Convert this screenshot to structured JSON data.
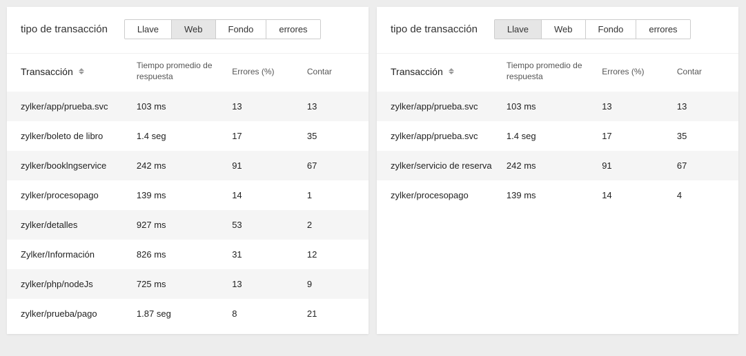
{
  "left": {
    "title": "tipo de transacción",
    "tabs": [
      {
        "label": "Llave",
        "active": false
      },
      {
        "label": "Web",
        "active": true
      },
      {
        "label": "Fondo",
        "active": false
      },
      {
        "label": "errores",
        "active": false
      }
    ],
    "headers": {
      "transaction": "Transacción",
      "avg_response": "Tiempo promedio de respuesta",
      "errors": "Errores (%)",
      "count": "Contar"
    },
    "rows": [
      {
        "tx": "zylker/app/prueba.svc",
        "rt": "103 ms",
        "err": "13",
        "cnt": "13"
      },
      {
        "tx": "zylker/boleto de libro",
        "rt": "1.4 seg",
        "err": "17",
        "cnt": "35"
      },
      {
        "tx": "zylker/booklngservice",
        "rt": "242 ms",
        "err": "91",
        "cnt": "67"
      },
      {
        "tx": "zylker/procesopago",
        "rt": "139 ms",
        "err": "14",
        "cnt": "1"
      },
      {
        "tx": "zylker/detalles",
        "rt": "927 ms",
        "err": "53",
        "cnt": "2"
      },
      {
        "tx": "Zylker/Información",
        "rt": "826 ms",
        "err": "31",
        "cnt": "12"
      },
      {
        "tx": "zylker/php/nodeJs",
        "rt": "725 ms",
        "err": "13",
        "cnt": "9"
      },
      {
        "tx": "zylker/prueba/pago",
        "rt": "1.87 seg",
        "err": "8",
        "cnt": "21"
      }
    ]
  },
  "right": {
    "title": "tipo de transacción",
    "tabs": [
      {
        "label": "Llave",
        "active": true
      },
      {
        "label": "Web",
        "active": false
      },
      {
        "label": "Fondo",
        "active": false
      },
      {
        "label": "errores",
        "active": false
      }
    ],
    "headers": {
      "transaction": "Transacción",
      "avg_response": "Tiempo promedio de respuesta",
      "errors": "Errores (%)",
      "count": "Contar"
    },
    "rows": [
      {
        "tx": "zylker/app/prueba.svc",
        "rt": "103 ms",
        "err": "13",
        "cnt": "13"
      },
      {
        "tx": "zylker/app/prueba.svc",
        "rt": "1.4 seg",
        "err": "17",
        "cnt": "35"
      },
      {
        "tx": "zylker/servicio de reserva",
        "rt": "242 ms",
        "err": "91",
        "cnt": "67"
      },
      {
        "tx": "zylker/procesopago",
        "rt": "139 ms",
        "err": "14",
        "cnt": "4"
      }
    ]
  }
}
